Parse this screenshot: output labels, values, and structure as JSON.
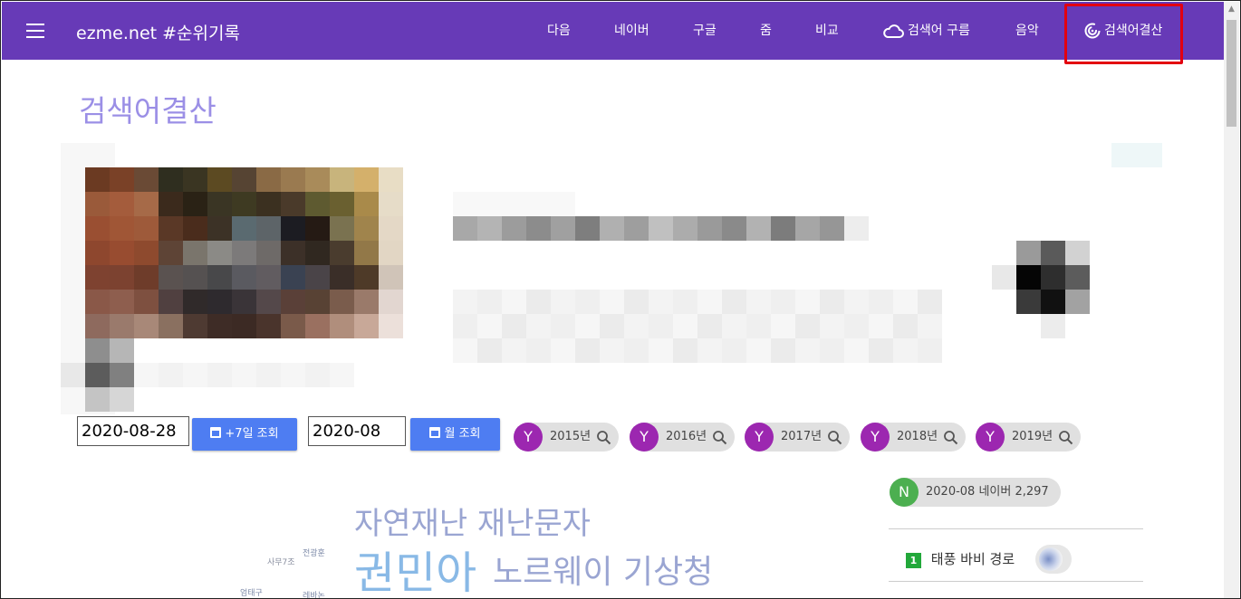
{
  "header": {
    "brand": "ezme.net #순위기록",
    "nav": [
      {
        "label": "다음"
      },
      {
        "label": "네이버"
      },
      {
        "label": "구글"
      },
      {
        "label": "줌"
      },
      {
        "label": "비교"
      },
      {
        "label": "검색어 구름",
        "icon": "cloud-icon"
      },
      {
        "label": "음악"
      },
      {
        "label": "검색어결산",
        "icon": "target-icon",
        "active": true
      }
    ]
  },
  "page_title": "검색어결산",
  "controls": {
    "date_value": "2020-08-28",
    "week_button": "+7일 조회",
    "month_value": "2020-08",
    "month_button": "월 조회",
    "year_chips": [
      {
        "avatar": "Y",
        "label": "2015년"
      },
      {
        "avatar": "Y",
        "label": "2016년"
      },
      {
        "avatar": "Y",
        "label": "2017년"
      },
      {
        "avatar": "Y",
        "label": "2018년"
      },
      {
        "avatar": "Y",
        "label": "2019년"
      }
    ]
  },
  "side_panel": {
    "source_chip": {
      "avatar": "N",
      "label": "2020-08 네이버 2,297"
    },
    "ranks": [
      {
        "rank": "1",
        "keyword": "태풍 바비 경로"
      }
    ]
  },
  "word_cloud": {
    "words": [
      "자연재난 재난문자",
      "권민아",
      "노르웨이 기상청",
      "전광훈",
      "사무7조",
      "엄태구",
      "레바논"
    ]
  },
  "colors": {
    "header": "#673ab7",
    "button": "#4e7df2",
    "year_avatar": "#9c27b0",
    "naver_avatar": "#4caf50",
    "title": "#9b8fe6",
    "highlight": "#e3000f"
  }
}
